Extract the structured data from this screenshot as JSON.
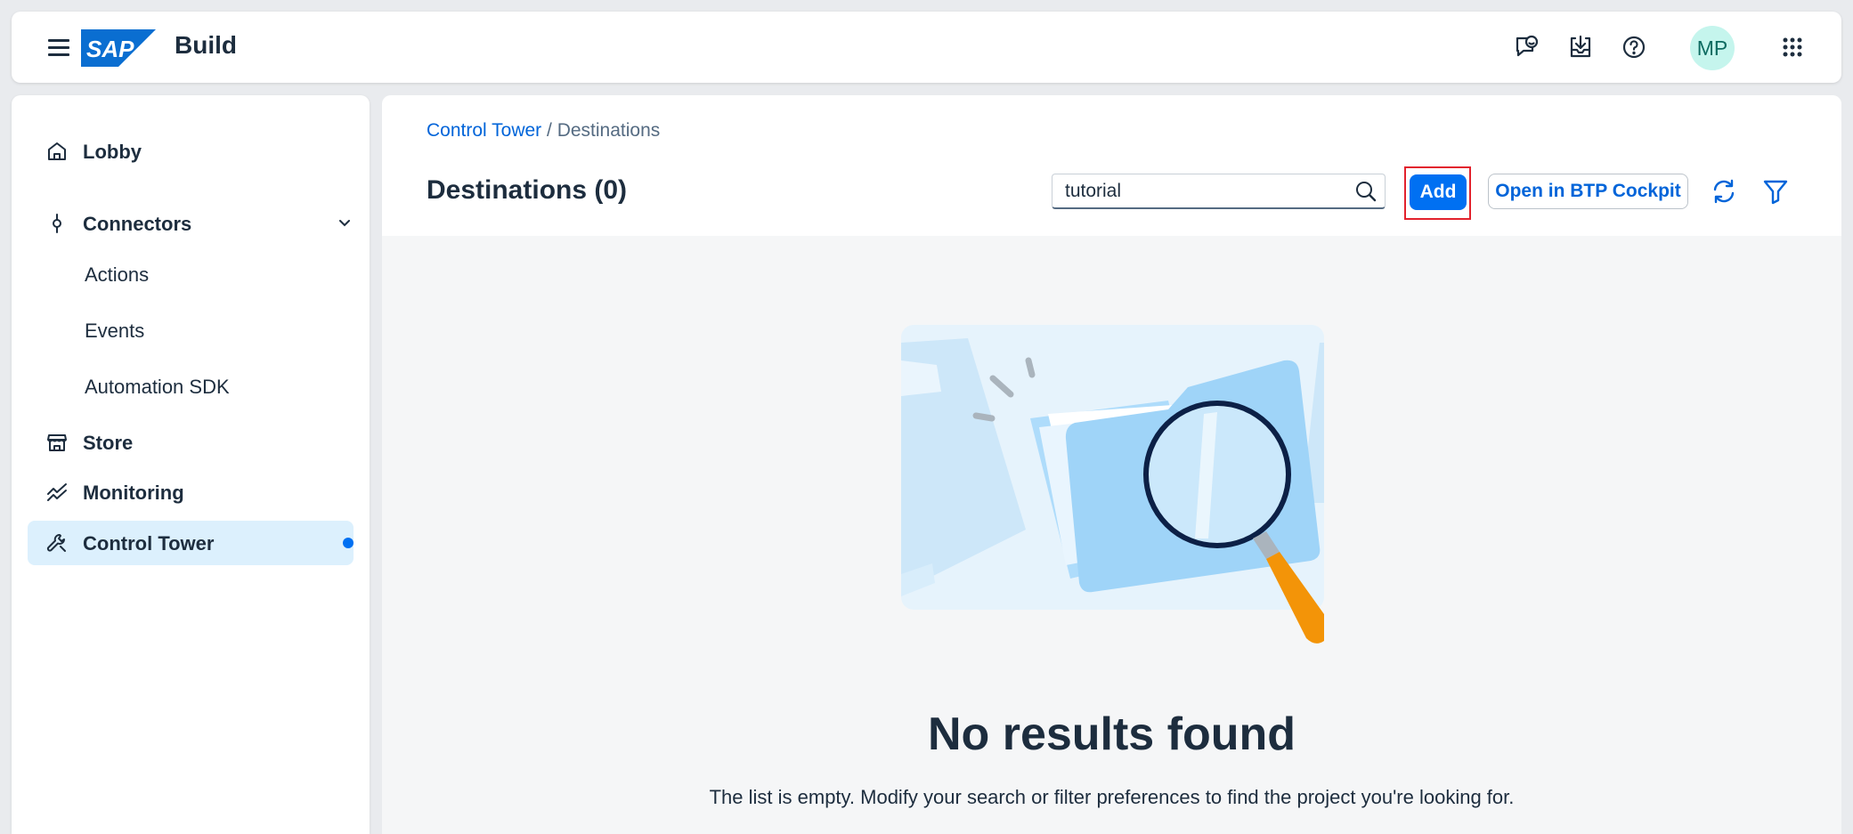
{
  "shell": {
    "logo_text": "SAP",
    "product_name": "Build",
    "avatar_initials": "MP",
    "icons": [
      "feedback-icon",
      "inbox-icon",
      "help-icon",
      "product-switch-icon"
    ]
  },
  "sidebar": {
    "items": [
      {
        "label": "Lobby",
        "icon": "home-icon"
      },
      {
        "label": "Connectors",
        "icon": "connector-icon",
        "expanded": true
      },
      {
        "label": "Actions",
        "sub": true
      },
      {
        "label": "Events",
        "sub": true
      },
      {
        "label": "Automation SDK",
        "sub": true
      },
      {
        "label": "Store",
        "icon": "store-icon"
      },
      {
        "label": "Monitoring",
        "icon": "line-chart-icon"
      },
      {
        "label": "Control Tower",
        "icon": "wrench-icon",
        "selected": true
      }
    ]
  },
  "breadcrumb": {
    "link": "Control Tower",
    "separator": " / ",
    "current": "Destinations"
  },
  "page": {
    "title": "Destinations (0)",
    "search_value": "tutorial",
    "add_label": "Add",
    "open_btp_label": "Open in BTP Cockpit"
  },
  "empty_state": {
    "title": "No results found",
    "description": "The list is empty. Modify your search or filter preferences to find the project you're looking for."
  },
  "colors": {
    "accent": "#0070f2",
    "link": "#0064d9",
    "selected_bg": "#dcf0fd",
    "highlight": "#e2222d",
    "avatar_bg": "#c5f5ed"
  }
}
